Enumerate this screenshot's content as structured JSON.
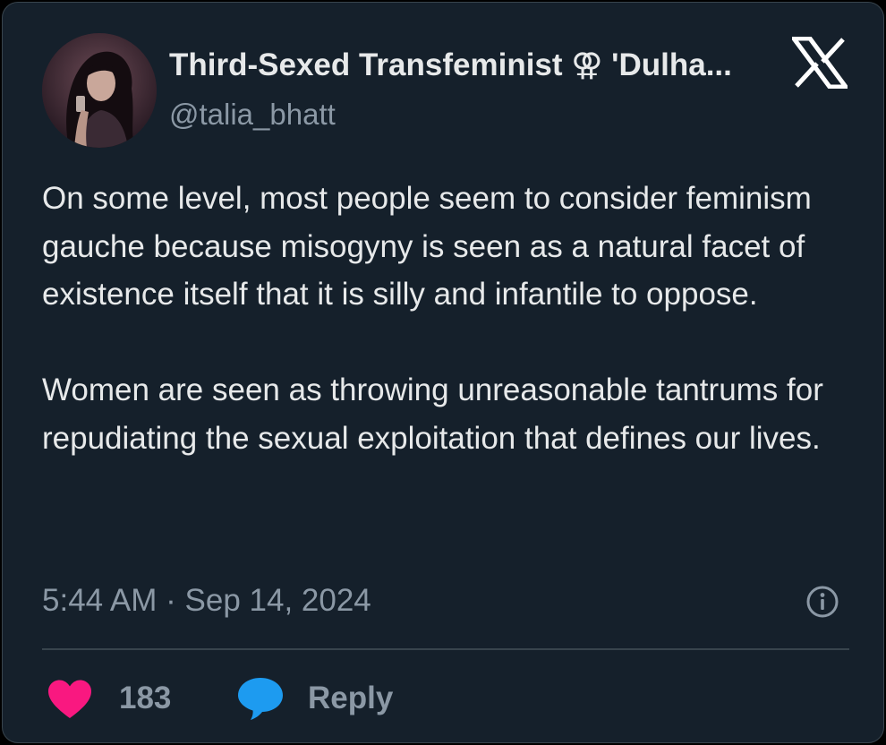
{
  "user": {
    "display_name": "Third-Sexed Transfeminist ⚢ 'Dulha...",
    "handle": "@talia_bhatt",
    "avatar_icon": "avatar"
  },
  "tweet": {
    "paragraphs": [
      "On some level, most people seem to consider feminism gauche because misogyny is seen as a natural facet of existence itself that it is silly and infantile to oppose.",
      "Women are seen as throwing unreasonable tantrums for repudiating the sexual exploitation that defines our lives."
    ],
    "timestamp": "5:44 AM · Sep 14, 2024"
  },
  "actions": {
    "like_count": "183",
    "reply_label": "Reply",
    "like_icon": "heart-icon",
    "reply_icon": "speech-bubble-icon",
    "info_icon": "info-icon"
  },
  "brand": {
    "logo_icon": "x-logo-icon"
  },
  "colors": {
    "background": "#15202b",
    "text": "#e7e9ea",
    "muted": "#8b98a5",
    "like": "#f91880",
    "reply": "#1d9bf0"
  }
}
